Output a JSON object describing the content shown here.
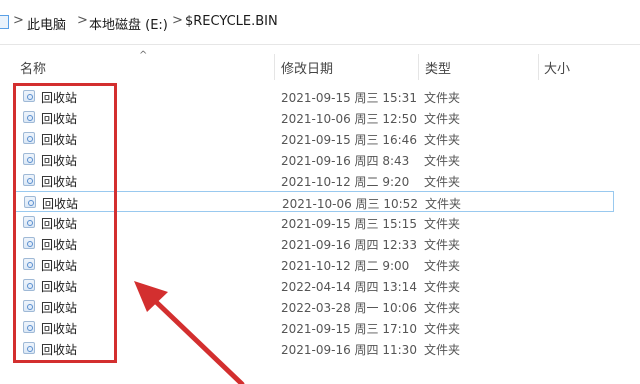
{
  "breadcrumb": {
    "items": [
      "此电脑",
      "本地磁盘 (E:)",
      "$RECYCLE.BIN"
    ],
    "separator": ">"
  },
  "columns": {
    "name": "名称",
    "date": "修改日期",
    "type": "类型",
    "size": "大小",
    "sort_indicator": "^"
  },
  "files": [
    {
      "name": "回收站",
      "date": "2021-09-15 周三 15:31",
      "type": "文件夹"
    },
    {
      "name": "回收站",
      "date": "2021-10-06 周三 12:50",
      "type": "文件夹"
    },
    {
      "name": "回收站",
      "date": "2021-09-15 周三 16:46",
      "type": "文件夹"
    },
    {
      "name": "回收站",
      "date": "2021-09-16 周四 8:43",
      "type": "文件夹"
    },
    {
      "name": "回收站",
      "date": "2021-10-12 周二 9:20",
      "type": "文件夹"
    },
    {
      "name": "回收站",
      "date": "2021-10-06 周三 10:52",
      "type": "文件夹"
    },
    {
      "name": "回收站",
      "date": "2021-09-15 周三 15:15",
      "type": "文件夹"
    },
    {
      "name": "回收站",
      "date": "2021-09-16 周四 12:33",
      "type": "文件夹"
    },
    {
      "name": "回收站",
      "date": "2021-10-12 周二 9:00",
      "type": "文件夹"
    },
    {
      "name": "回收站",
      "date": "2022-04-14 周四 13:14",
      "type": "文件夹"
    },
    {
      "name": "回收站",
      "date": "2022-03-28 周一 10:06",
      "type": "文件夹"
    },
    {
      "name": "回收站",
      "date": "2021-09-15 周三 17:10",
      "type": "文件夹"
    },
    {
      "name": "回收站",
      "date": "2021-09-16 周四 11:30",
      "type": "文件夹"
    }
  ],
  "selected_index": 5,
  "colors": {
    "annotation": "#d32f2f",
    "selection_border": "#99c9ef",
    "folder_icon": "#5a8fcf"
  },
  "icons": {
    "folder": "recycle-bin-folder-icon",
    "location": "this-pc-icon"
  }
}
